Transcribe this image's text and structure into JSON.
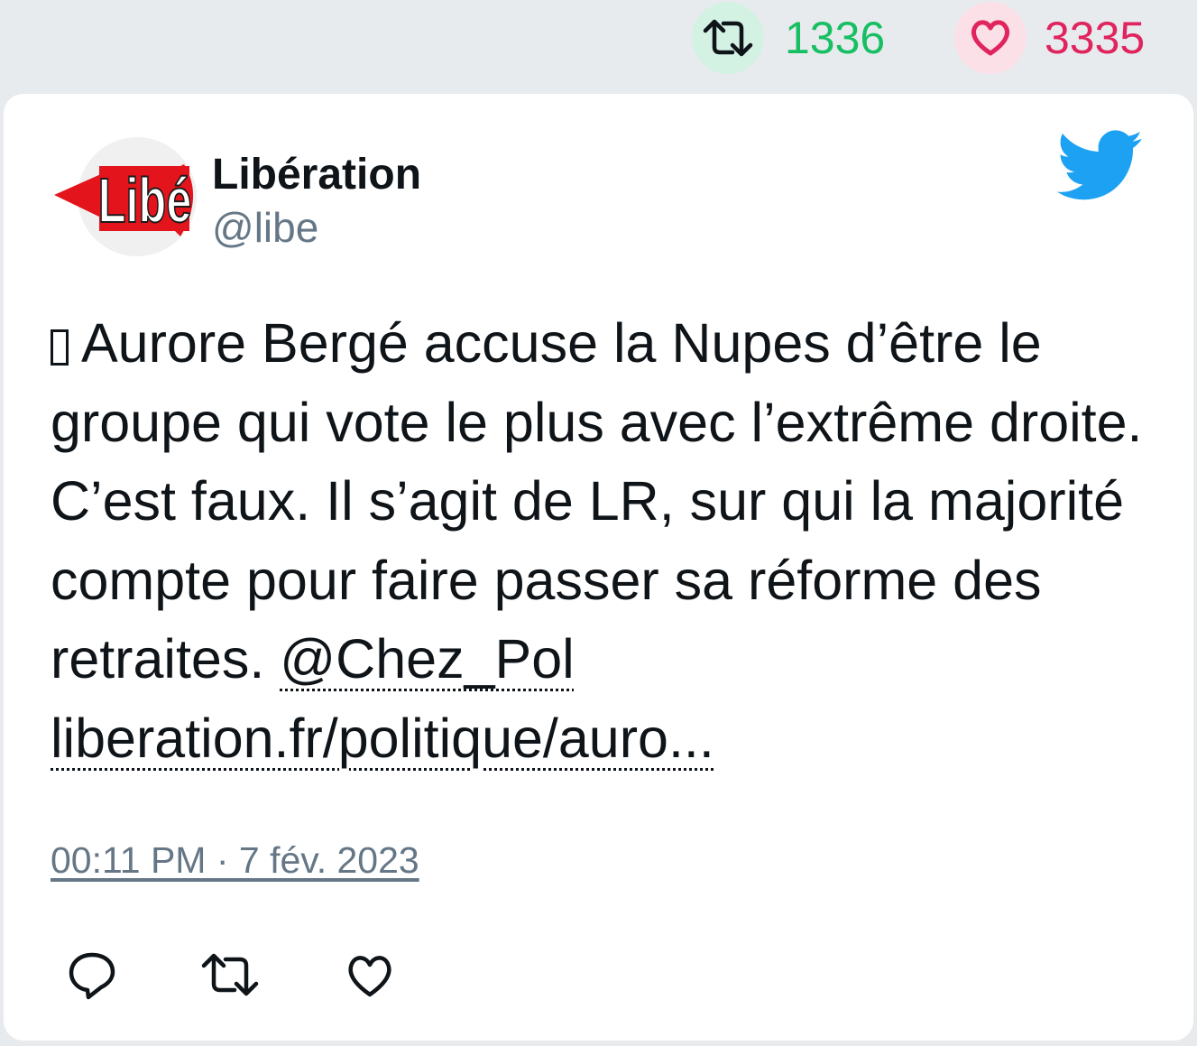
{
  "stats": {
    "retweets": "1336",
    "likes": "3335",
    "retweet_color": "#17bf63",
    "like_color": "#e0245e",
    "retweet_icon": "retweet-icon",
    "like_icon": "heart-icon"
  },
  "author": {
    "name": "Libération",
    "handle": "@libe",
    "avatar_logo_text": "Libé"
  },
  "tweet": {
    "text_prefix": "Aurore Bergé accuse la Nupes d’être le groupe qui vote le plus avec l’extrême droite. C’est faux. Il s’agit de LR, sur qui la majorité compte pour faire passer sa réforme des retraites. ",
    "mention": "@Chez_Pol",
    "link": "liberation.fr/politique/auro...",
    "timestamp": "00:11 PM · 7 fév. 2023"
  },
  "actions": [
    "reply-icon",
    "retweet-icon",
    "like-icon"
  ],
  "brand": {
    "twitter_blue": "#1da1f2"
  }
}
